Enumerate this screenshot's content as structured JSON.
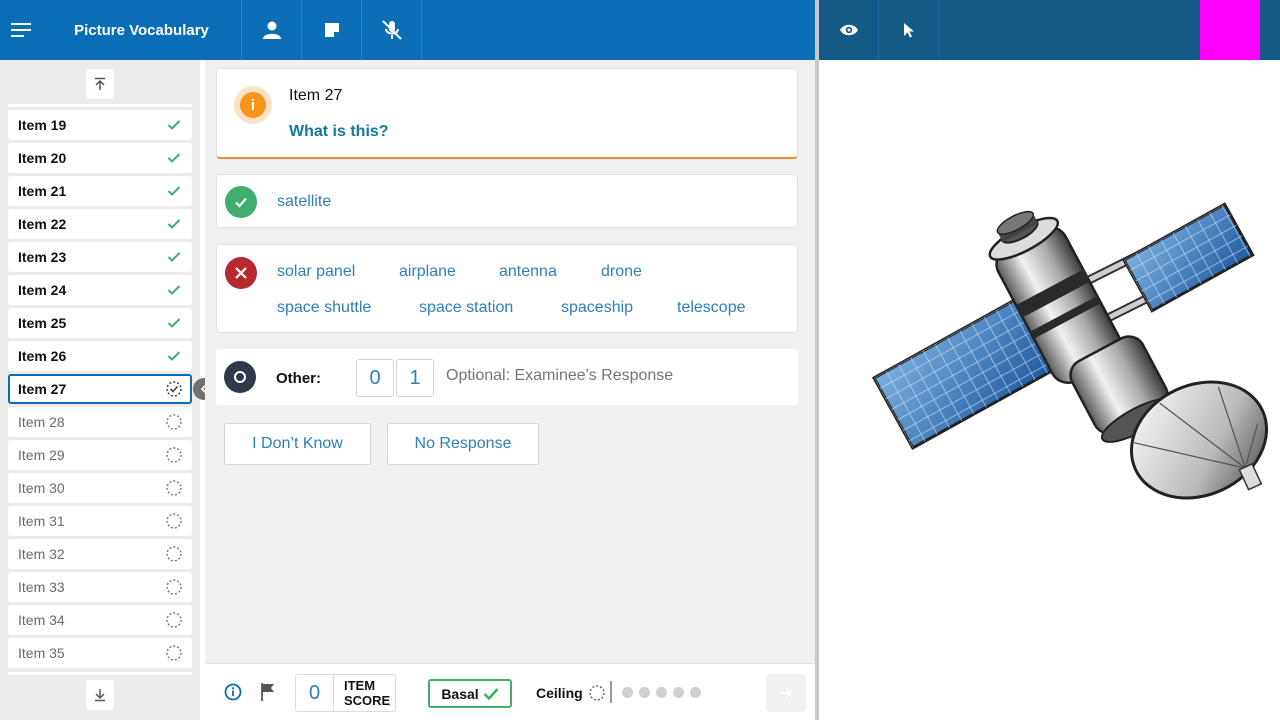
{
  "header": {
    "title": "Picture Vocabulary",
    "buttons": [
      "menu-icon",
      "person-icon",
      "note-icon",
      "mic-off-icon"
    ],
    "right_buttons": [
      "eye-icon",
      "pointer-icon"
    ]
  },
  "sidebar": {
    "items": [
      {
        "label": "Item 19",
        "status": "done"
      },
      {
        "label": "Item 20",
        "status": "done"
      },
      {
        "label": "Item 21",
        "status": "done"
      },
      {
        "label": "Item 22",
        "status": "done"
      },
      {
        "label": "Item 23",
        "status": "done"
      },
      {
        "label": "Item 24",
        "status": "done"
      },
      {
        "label": "Item 25",
        "status": "done"
      },
      {
        "label": "Item 26",
        "status": "done"
      },
      {
        "label": "Item 27",
        "status": "current"
      },
      {
        "label": "Item 28",
        "status": "todo"
      },
      {
        "label": "Item 29",
        "status": "todo"
      },
      {
        "label": "Item 30",
        "status": "todo"
      },
      {
        "label": "Item 31",
        "status": "todo"
      },
      {
        "label": "Item 32",
        "status": "todo"
      },
      {
        "label": "Item 33",
        "status": "todo"
      },
      {
        "label": "Item 34",
        "status": "todo"
      },
      {
        "label": "Item 35",
        "status": "todo"
      }
    ]
  },
  "question": {
    "title": "Item 27",
    "prompt": "What is this?"
  },
  "correct_responses": [
    "satellite"
  ],
  "incorrect_responses": [
    "solar panel",
    "airplane",
    "antenna",
    "drone",
    "space shuttle",
    "space station",
    "spaceship",
    "telescope"
  ],
  "other": {
    "label": "Other:",
    "score_options": [
      "0",
      "1"
    ],
    "placeholder": "Optional: Examinee's Response"
  },
  "actions": {
    "dont_know": "I Don’t Know",
    "no_response": "No Response"
  },
  "footer": {
    "item_score_value": "0",
    "item_score_label_1": "ITEM",
    "item_score_label_2": "SCORE",
    "basal_label": "Basal",
    "ceiling_label": "Ceiling",
    "ceiling_dots": 5
  },
  "colors": {
    "header": "#0b6db6",
    "header_right": "#135a87",
    "accent_magenta": "#ff00ff",
    "correct": "#3fae6f",
    "incorrect": "#b8292f",
    "info": "#f7941d",
    "link": "#2d7fbf"
  }
}
